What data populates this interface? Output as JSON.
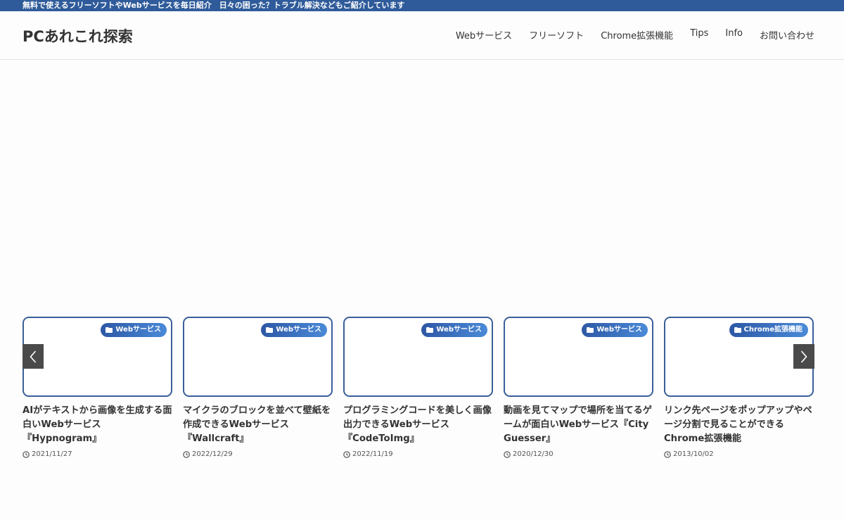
{
  "topbar": {
    "text": "無料で使えるフリーソフトやWebサービスを毎日紹介　日々の困った？トラブル解決などもご紹介しています"
  },
  "header": {
    "site_title": "PCあれこれ探索",
    "nav": [
      {
        "label": "Webサービス"
      },
      {
        "label": "フリーソフト"
      },
      {
        "label": "Chrome拡張機能"
      },
      {
        "label": "Tips"
      },
      {
        "label": "Info"
      },
      {
        "label": "お問い合わせ"
      }
    ]
  },
  "slider": {
    "prev_icon": "chevron-left-icon",
    "next_icon": "chevron-right-icon",
    "cards": [
      {
        "category": "Webサービス",
        "title": "AIがテキストから画像を生成する面白いWebサービス『Hypnogram』",
        "date": "2021/11/27"
      },
      {
        "category": "Webサービス",
        "title": "マイクラのブロックを並べて壁紙を作成できるWebサービス『Wallcraft』",
        "date": "2022/12/29"
      },
      {
        "category": "Webサービス",
        "title": "プログラミングコードを美しく画像出力できるWebサービス『CodeToImg』",
        "date": "2022/11/19"
      },
      {
        "category": "Webサービス",
        "title": "動画を見てマップで場所を当てるゲームが面白いWebサービス『City Guesser』",
        "date": "2020/12/30"
      },
      {
        "category": "Chrome拡張機能",
        "title": "リンク先ページをポップアップやページ分割で見ることができるChrome拡張機能",
        "date": "2013/10/02"
      }
    ]
  },
  "colors": {
    "topbar": "#2f5b9a",
    "card_border": "#3a5f99",
    "badge_start": "#2d58a5",
    "badge_end": "#4a8ad8",
    "arrow_bg": "#4a4a4a"
  }
}
